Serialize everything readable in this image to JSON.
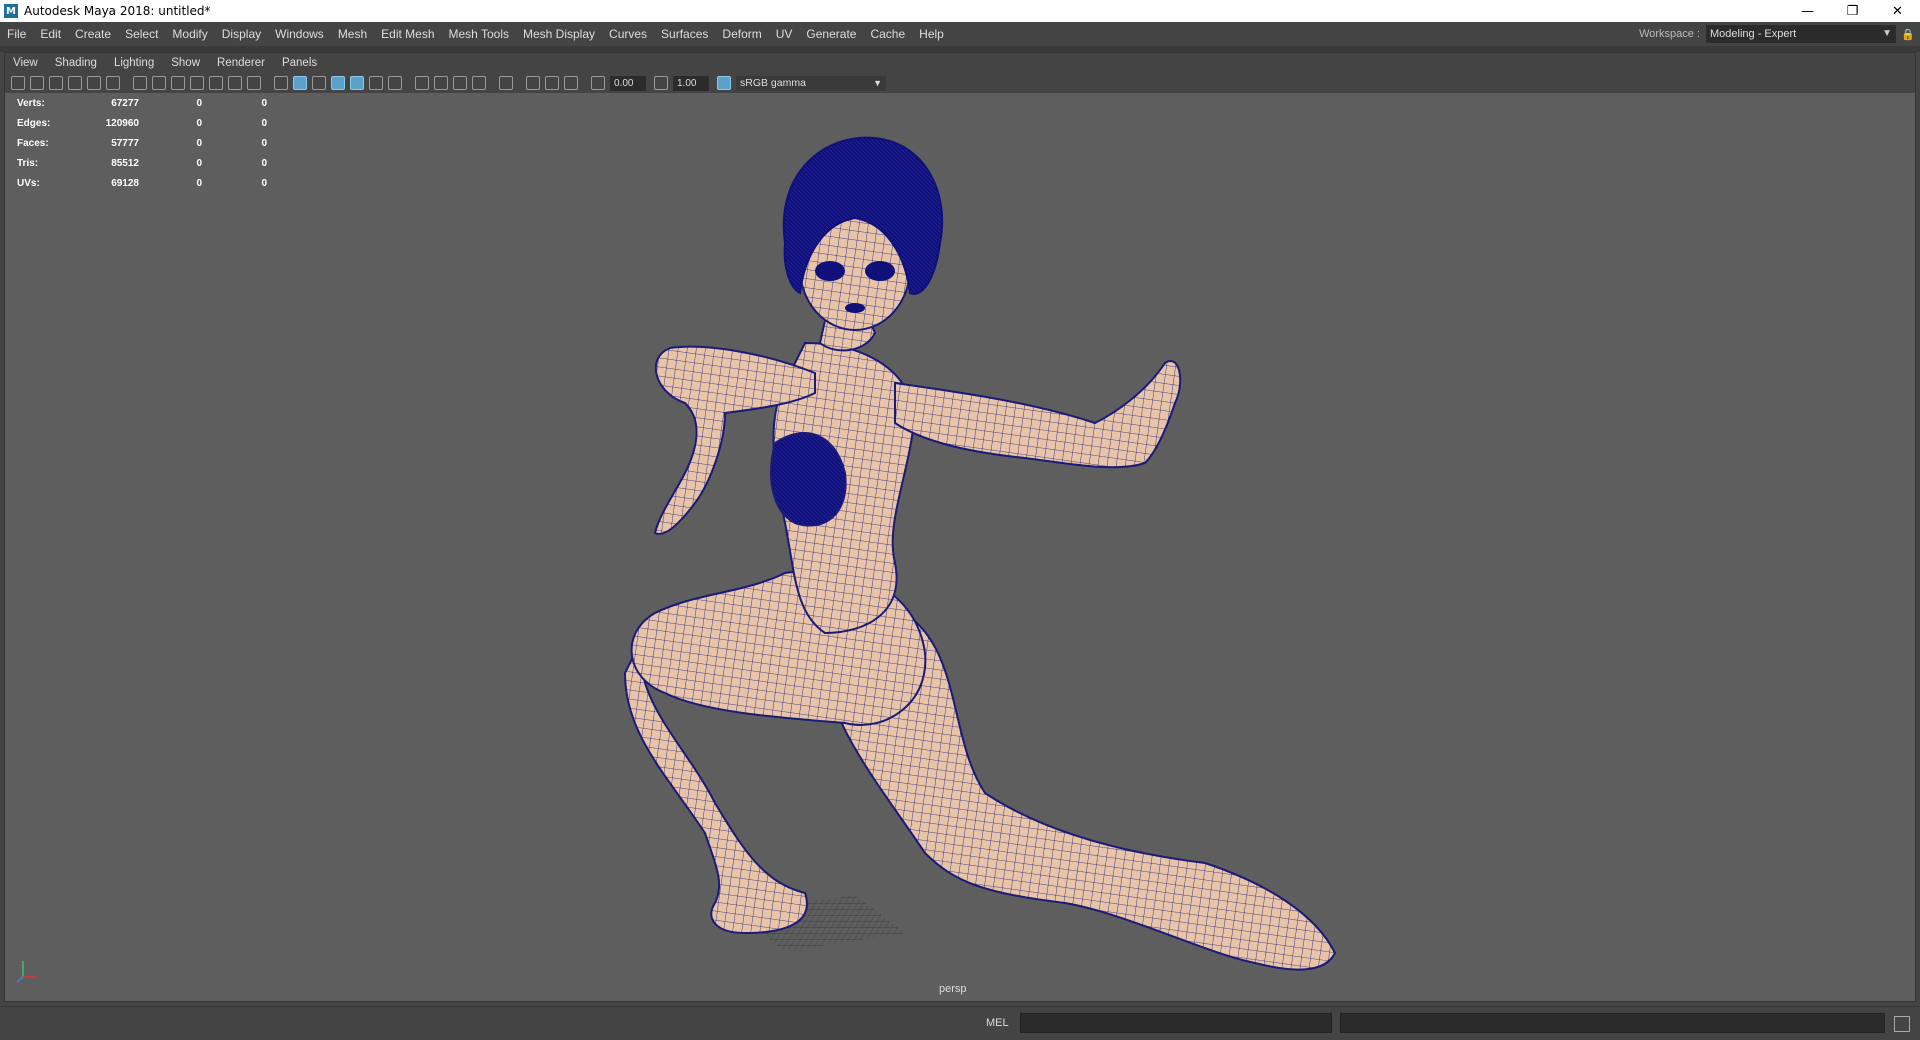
{
  "window": {
    "title": "Autodesk Maya 2018: untitled*",
    "logo_letter": "M",
    "minimize": "—",
    "restore": "❐",
    "close": "✕"
  },
  "menubar": {
    "items": [
      "File",
      "Edit",
      "Create",
      "Select",
      "Modify",
      "Display",
      "Windows",
      "Mesh",
      "Edit Mesh",
      "Mesh Tools",
      "Mesh Display",
      "Curves",
      "Surfaces",
      "Deform",
      "UV",
      "Generate",
      "Cache",
      "Help"
    ]
  },
  "workspace": {
    "label": "Workspace :",
    "value": "Modeling - Expert"
  },
  "panel": {
    "menu": [
      "View",
      "Shading",
      "Lighting",
      "Show",
      "Renderer",
      "Panels"
    ],
    "exposure": "0.00",
    "gamma": "1.00",
    "color_management": "sRGB gamma"
  },
  "hud": {
    "rows": [
      {
        "label": "Verts:",
        "total": "67277",
        "selected": "0",
        "components": "0"
      },
      {
        "label": "Edges:",
        "total": "120960",
        "selected": "0",
        "components": "0"
      },
      {
        "label": "Faces:",
        "total": "57777",
        "selected": "0",
        "components": "0"
      },
      {
        "label": "Tris:",
        "total": "85512",
        "selected": "0",
        "components": "0"
      },
      {
        "label": "UVs:",
        "total": "69128",
        "selected": "0",
        "components": "0"
      }
    ]
  },
  "viewport": {
    "camera": "persp",
    "background_color": "#5e5e5e",
    "mesh_color": "#e8c4a8",
    "wire_color": "#1a1a78",
    "hair_color": "#10107a"
  },
  "commandline": {
    "language": "MEL"
  }
}
